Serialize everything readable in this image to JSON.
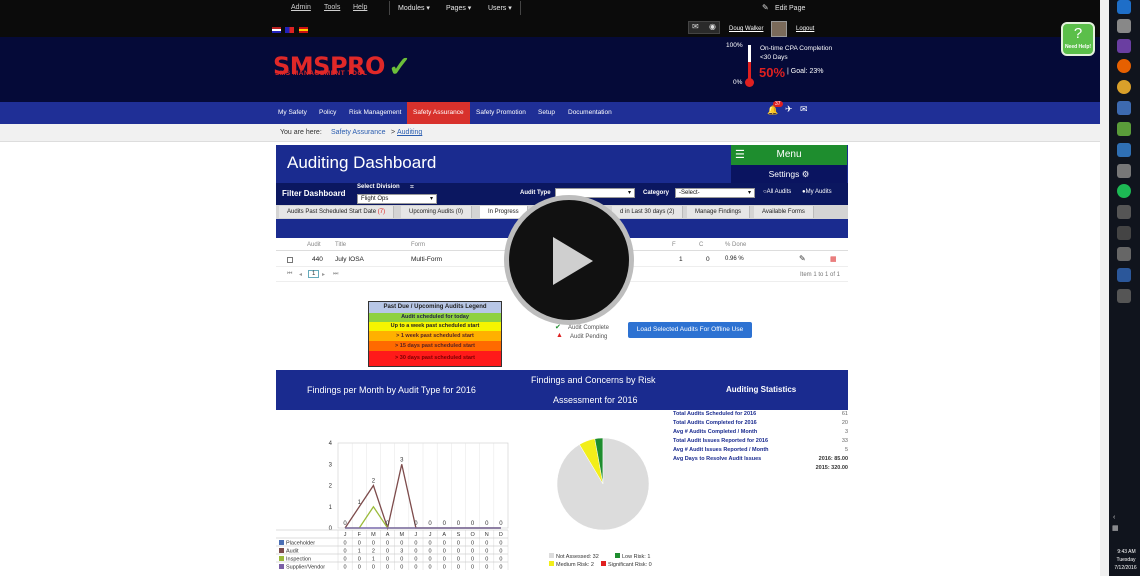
{
  "topbar": {
    "links": [
      "Admin",
      "Tools",
      "Help"
    ],
    "menus": [
      "Modules",
      "Pages",
      "Users"
    ],
    "edit_page": "Edit Page",
    "user_name": "Doug Walker",
    "logout": "Logout"
  },
  "header": {
    "logo_text": "SMSPRO",
    "logo_sub": "SMS MANAGEMENT TOOL",
    "gauge_top": "100%",
    "gauge_bottom": "0%",
    "cpa_title": "On-time CPA Completion",
    "cpa_sub": "<30 Days",
    "cpa_value": "50%",
    "cpa_goal": "| Goal: 23%",
    "notif_count": "37"
  },
  "nav": {
    "items": [
      "My Safety",
      "Policy",
      "Risk Management",
      "Safety Assurance",
      "Safety Promotion",
      "Setup",
      "Documentation"
    ]
  },
  "breadcrumb": {
    "prefix": "You are here:",
    "parent": "Safety Assurance",
    "sep": ">",
    "current": "Auditing"
  },
  "dashboard": {
    "title": "Auditing Dashboard",
    "menu_label": "Menu",
    "settings_label": "Settings",
    "filter_label": "Filter Dashboard",
    "division_label": "Select Division",
    "division_value": "Flight Ops",
    "audit_type_label": "Audit Type",
    "category_label": "Category",
    "category_value": "-Select-",
    "all_audits": "All Audits",
    "my_audits": "My Audits"
  },
  "tabs": [
    {
      "label": "Audits Past Scheduled Start Date",
      "count": "(7)"
    },
    {
      "label": "Upcoming Audits",
      "count": "(0)"
    },
    {
      "label": "In Progress",
      "count": ""
    },
    {
      "label": "d in Last 30 days",
      "count": "(2)"
    },
    {
      "label": "Manage Findings",
      "count": ""
    },
    {
      "label": "Available Forms",
      "count": ""
    }
  ],
  "table": {
    "headers": [
      "Audit",
      "Title",
      "Form",
      "F",
      "C",
      "% Done"
    ],
    "row": {
      "audit": "440",
      "title": "July IOSA",
      "form": "Multi-Form",
      "f": "1",
      "c": "0",
      "done": "0.96 %"
    },
    "pager_page": "1",
    "pager_info": "Item 1 to 1 of 1"
  },
  "legend": {
    "title": "Past Due / Upcoming Audits Legend",
    "rows": [
      {
        "text": "Audit scheduled for today",
        "color": "#8fd13f"
      },
      {
        "text": "Up to a week past scheduled start",
        "color": "#f5f500"
      },
      {
        "text": "> 1 week past scheduled start",
        "color": "#ffb000"
      },
      {
        "text": "> 15 days past scheduled start",
        "color": "#ff6a00"
      },
      {
        "text": "> 30 days past scheduled start",
        "color": "#ff1a1a"
      }
    ],
    "audit_complete": "Audit Complete",
    "audit_pending": "Audit Pending",
    "offline_button": "Load Selected Audits For Offline Use"
  },
  "charts_header": {
    "findings_title": "Findings per Month by Audit Type for 2016",
    "concerns_title_1": "Findings and Concerns by Risk",
    "concerns_title_2": "Assessment for 2016",
    "stats_title": "Auditing Statistics"
  },
  "stats": [
    {
      "label": "Total Audits Scheduled for 2016",
      "value": "61"
    },
    {
      "label": "Total Audits Completed for 2016",
      "value": "20"
    },
    {
      "label": "Avg # Audits Completed / Month",
      "value": "3"
    },
    {
      "label": "Total Audit Issues Reported for 2016",
      "value": "33"
    },
    {
      "label": "Avg # Audit Issues Reported / Month",
      "value": "5"
    },
    {
      "label": "Avg Days to Resolve Audit Issues",
      "value": "2016: 85.00"
    },
    {
      "label": "",
      "value": "2015: 320.00"
    }
  ],
  "chart_data": [
    {
      "type": "line",
      "categories": [
        "J",
        "F",
        "M",
        "A",
        "M",
        "J",
        "J",
        "A",
        "S",
        "O",
        "N",
        "D"
      ],
      "ylim": [
        0,
        4
      ],
      "yticks": [
        "0",
        "1",
        "2",
        "3",
        "4"
      ],
      "series": [
        {
          "name": "Placeholder",
          "values": [
            0,
            0,
            0,
            0,
            0,
            0,
            0,
            0,
            0,
            0,
            0,
            0
          ],
          "color": "#4a6fb5"
        },
        {
          "name": "Audit",
          "values": [
            0,
            1,
            2,
            0,
            3,
            0,
            0,
            0,
            0,
            0,
            0,
            0
          ],
          "color": "#7d4b4b"
        },
        {
          "name": "Inspection",
          "values": [
            0,
            0,
            1,
            0,
            0,
            0,
            0,
            0,
            0,
            0,
            0,
            0
          ],
          "color": "#9bbb3a"
        },
        {
          "name": "Supplier/Vendor",
          "values": [
            0,
            0,
            0,
            0,
            0,
            0,
            0,
            0,
            0,
            0,
            0,
            0
          ],
          "color": "#7a5fa6"
        }
      ],
      "data_labels": [
        "0",
        "1",
        "2",
        "0",
        "3",
        "0",
        "0",
        "0",
        "0",
        "0",
        "0",
        "0"
      ]
    },
    {
      "type": "pie",
      "slices": [
        {
          "name": "Not Assessed",
          "value": 32,
          "color": "#dcdcdc"
        },
        {
          "name": "Low Risk",
          "value": 1,
          "color": "#1e8d2e"
        },
        {
          "name": "Medium Risk",
          "value": 2,
          "color": "#f2ee1a"
        },
        {
          "name": "Significant Risk",
          "value": 0,
          "color": "#e02020"
        }
      ],
      "legend_labels": [
        "Not Assessed: 32",
        "Low Risk: 1",
        "Medium Risk: 2",
        "Significant Risk: 0"
      ]
    }
  ],
  "help": {
    "label": "Need Help!"
  },
  "taskbar": {
    "time": "9:43 AM",
    "day": "Tuesday",
    "date": "7/12/2016"
  }
}
